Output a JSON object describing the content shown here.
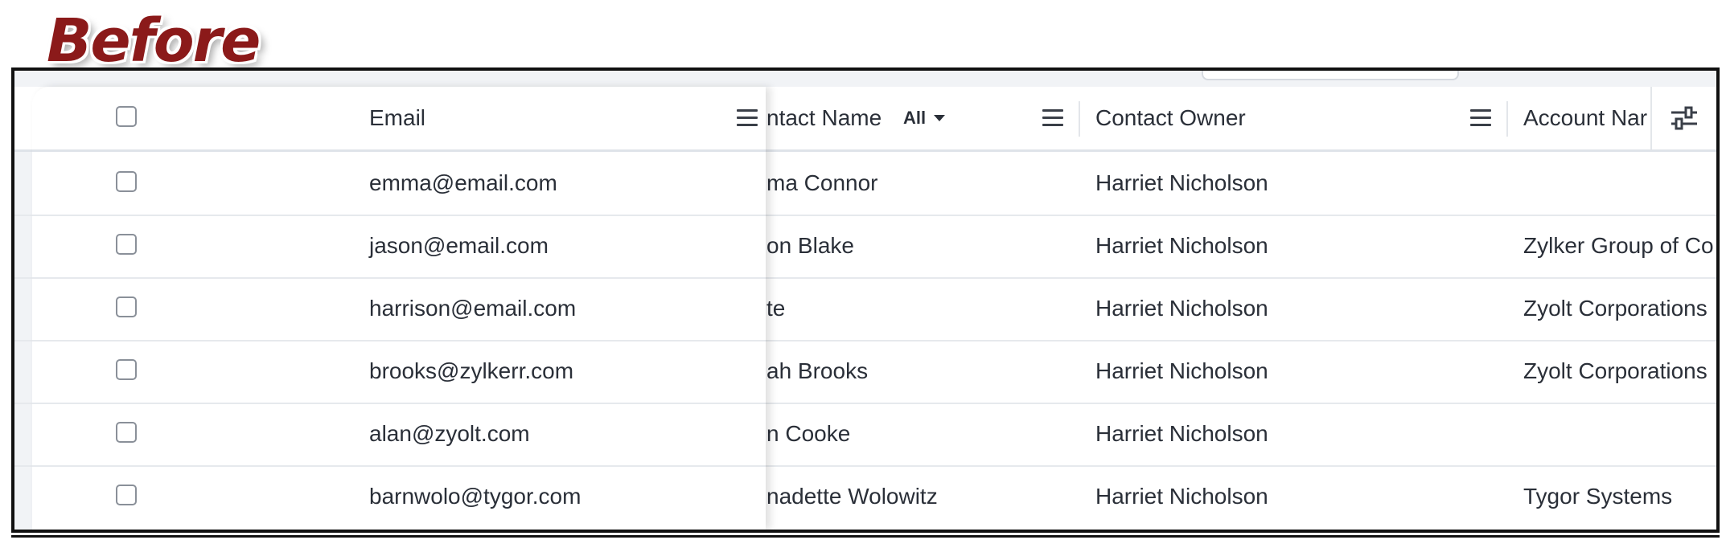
{
  "badge": "Before",
  "columns": {
    "email": "Email",
    "contact_name": "ntact Name",
    "contact_name_filter": "All",
    "contact_owner": "Contact Owner",
    "account_name": "Account Nar"
  },
  "rows": [
    {
      "email": "emma@email.com",
      "contact_name": "ma Connor",
      "owner": "Harriet Nicholson",
      "account": ""
    },
    {
      "email": "jason@email.com",
      "contact_name": "on Blake",
      "owner": "Harriet Nicholson",
      "account": "Zylker Group of Co"
    },
    {
      "email": "harrison@email.com",
      "contact_name": "te",
      "owner": "Harriet Nicholson",
      "account": "Zyolt Corporations"
    },
    {
      "email": "brooks@zylkerr.com",
      "contact_name": "ah Brooks",
      "owner": "Harriet Nicholson",
      "account": "Zyolt Corporations"
    },
    {
      "email": "alan@zyolt.com",
      "contact_name": "n Cooke",
      "owner": "Harriet Nicholson",
      "account": ""
    },
    {
      "email": "barnwolo@tygor.com",
      "contact_name": "nadette Wolowitz",
      "owner": "Harriet Nicholson",
      "account": "Tygor Systems"
    }
  ],
  "colors": {
    "badge": "#8b1a1a",
    "frame": "#111111",
    "text": "#2a2f38"
  }
}
